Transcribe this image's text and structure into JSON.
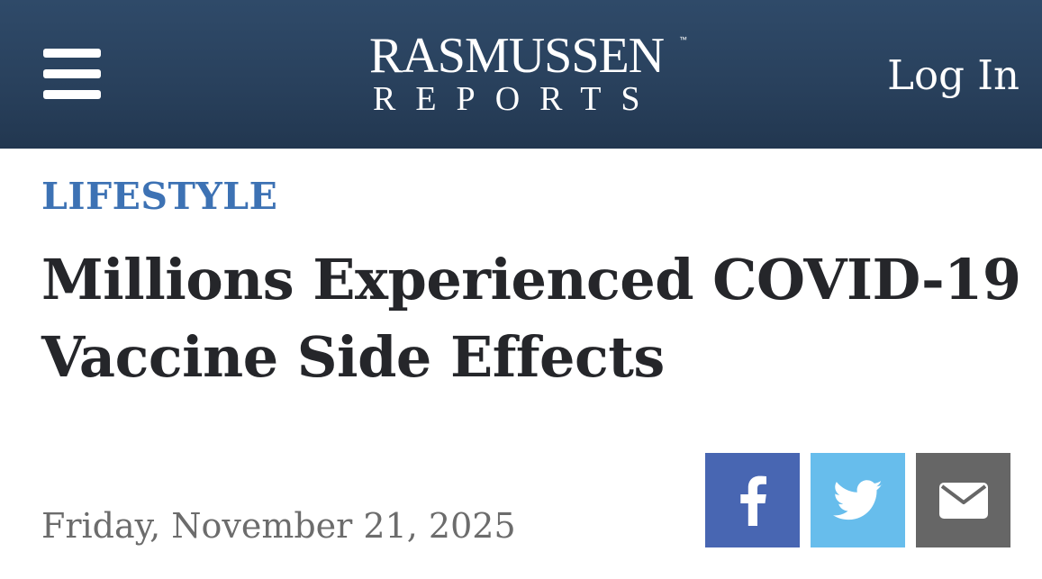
{
  "header": {
    "menu_icon": "hamburger-menu-icon",
    "logo": {
      "line1": "RASMUSSEN",
      "trademark": "™",
      "line2": "REPORTS"
    },
    "login_label": "Log In",
    "background_color": "#2b4462"
  },
  "article": {
    "category": "LIFESTYLE",
    "category_color": "#3d72b4",
    "headline": "Millions Experienced COVID-19 Vaccine Side Effects",
    "date": "Friday, November 21, 2025"
  },
  "share": [
    {
      "name": "facebook",
      "icon": "facebook-icon",
      "color": "#4866b2"
    },
    {
      "name": "twitter",
      "icon": "twitter-icon",
      "color": "#67bdec"
    },
    {
      "name": "email",
      "icon": "envelope-icon",
      "color": "#666666"
    }
  ]
}
